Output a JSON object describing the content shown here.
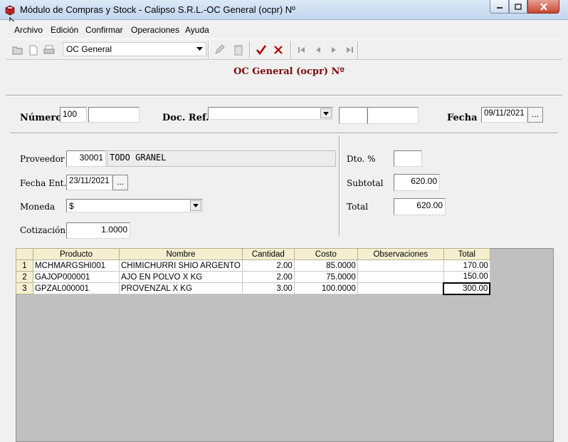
{
  "window": {
    "title": "Módulo de Compras y Stock - Calipso S.R.L.-OC General (ocpr) Nº"
  },
  "menu": [
    "Archivo",
    "Edición",
    "Confirmar",
    "Operaciones",
    "Ayuda"
  ],
  "toolbar": {
    "view_selected": "OC General",
    "icons": [
      "open-folder-icon",
      "new-document-icon",
      "print-icon",
      "edit-pencil-icon",
      "delete-trash-icon",
      "confirm-check-icon",
      "cancel-x-icon",
      "first-record-icon",
      "previous-record-icon",
      "next-record-icon",
      "last-record-icon"
    ]
  },
  "header": {
    "form_title": "OC General (ocpr) Nº",
    "numero_label": "Número",
    "numero_value": "100",
    "numero_extra": "",
    "docref_label": "Doc. Ref.",
    "docref_value": "",
    "docref_field2": "",
    "docref_field3": "",
    "fecha_label": "Fecha",
    "fecha_value": "09/11/2021",
    "dots": "..."
  },
  "form": {
    "proveedor_label": "Proveedor",
    "proveedor_code": "30001",
    "proveedor_name": "TODO GRANEL",
    "fecha_ent_label": "Fecha Ent.",
    "fecha_ent_value": "23/11/2021",
    "moneda_label": "Moneda",
    "moneda_value": "$",
    "cotizacion_label": "Cotización",
    "cotizacion_value": "1.0000",
    "dto_label": "Dto. %",
    "dto_value": "",
    "subtotal_label": "Subtotal",
    "subtotal_value": "620.00",
    "total_label": "Total",
    "total_value": "620.00"
  },
  "grid": {
    "columns": [
      "Producto",
      "Nombre",
      "Cantidad",
      "Costo",
      "Observaciones",
      "Total"
    ],
    "rows": [
      {
        "n": "1",
        "producto": "MCHMARGSHI001",
        "nombre": "CHIMICHURRI SHIO ARGENTO",
        "cantidad": "2.00",
        "costo": "85.0000",
        "obs": "",
        "total": "170.00"
      },
      {
        "n": "2",
        "producto": "GAJOP000001",
        "nombre": "AJO EN POLVO X KG",
        "cantidad": "2.00",
        "costo": "75.0000",
        "obs": "",
        "total": "150.00"
      },
      {
        "n": "3",
        "producto": "GPZAL000001",
        "nombre": "PROVENZAL X KG",
        "cantidad": "3.00",
        "costo": "100.0000",
        "obs": "",
        "total": "300.00"
      }
    ]
  },
  "colors": {
    "title_red": "#7a0a0a",
    "grid_header": "#f5efcf",
    "check_red": "#b00000"
  }
}
